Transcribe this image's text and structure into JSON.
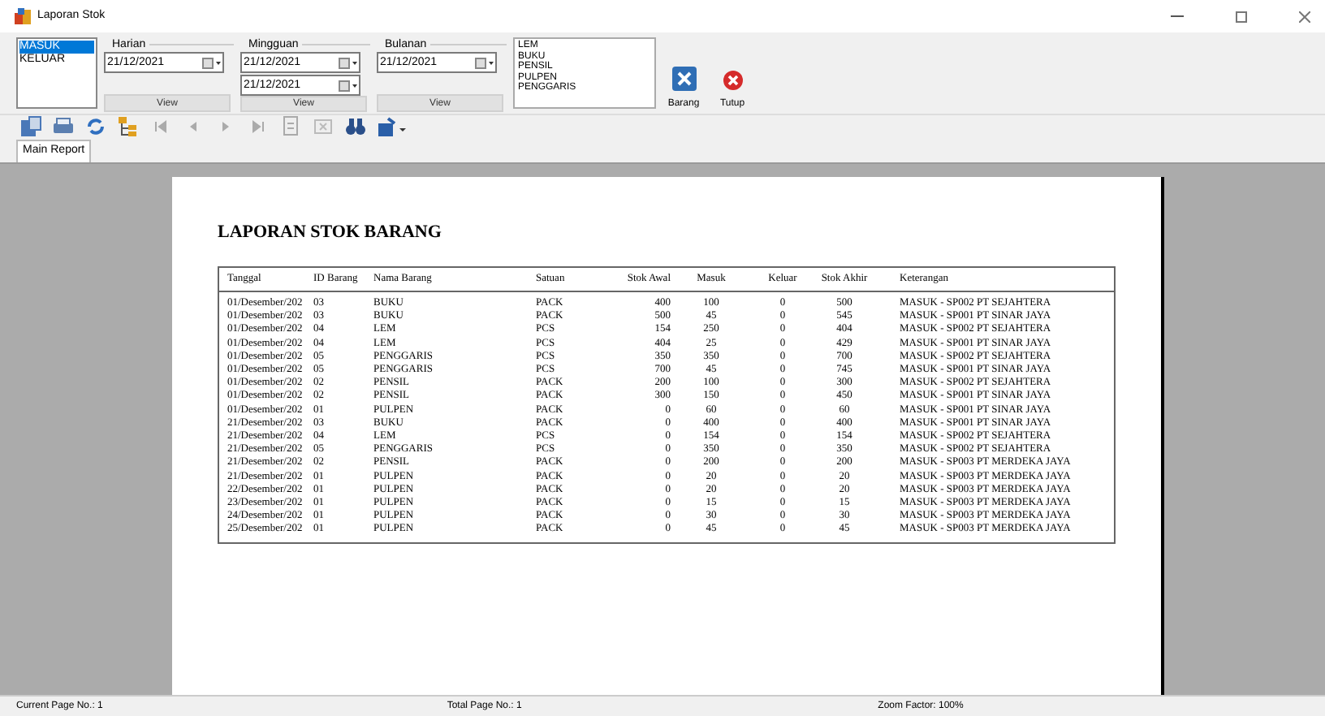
{
  "window": {
    "title": "Laporan Stok"
  },
  "type_list": [
    {
      "label": "MASUK",
      "selected": true
    },
    {
      "label": "KELUAR",
      "selected": false
    }
  ],
  "filters": [
    {
      "title": "Harian",
      "dates": [
        "21/12/2021"
      ],
      "button": "View"
    },
    {
      "title": "Mingguan",
      "dates": [
        "21/12/2021",
        "21/12/2021"
      ],
      "button": "View"
    },
    {
      "title": "Bulanan",
      "dates": [
        "21/12/2021"
      ],
      "button": "View"
    }
  ],
  "products": [
    "LEM",
    "BUKU",
    "PENSIL",
    "PULPEN",
    "PENGGARIS"
  ],
  "actions": [
    {
      "kind": "tools",
      "label": "Barang"
    },
    {
      "kind": "close",
      "label": "Tutup"
    }
  ],
  "report_tab": {
    "label": "Main Report",
    "selected": true
  },
  "report": {
    "title": "LAPORAN STOK BARANG",
    "columns": [
      "Tanggal",
      "ID Barang",
      "Nama Barang",
      "Satuan",
      "Stok Awal",
      "Masuk",
      "Keluar",
      "Stok Akhir",
      "Keterangan"
    ],
    "rows": [
      [
        "01/Desember/202",
        "03",
        "BUKU",
        "PACK",
        "400",
        "100",
        "0",
        "500",
        "MASUK - SP002 PT SEJAHTERA"
      ],
      [
        "01/Desember/202",
        "03",
        "BUKU",
        "PACK",
        "500",
        "45",
        "0",
        "545",
        "MASUK - SP001 PT SINAR JAYA"
      ],
      [
        "01/Desember/202",
        "04",
        "LEM",
        "PCS",
        "154",
        "250",
        "0",
        "404",
        "MASUK - SP002 PT SEJAHTERA"
      ],
      [
        "01/Desember/202",
        "04",
        "LEM",
        "PCS",
        "404",
        "25",
        "0",
        "429",
        "MASUK - SP001 PT SINAR JAYA"
      ],
      [
        "01/Desember/202",
        "05",
        "PENGGARIS",
        "PCS",
        "350",
        "350",
        "0",
        "700",
        "MASUK - SP002 PT SEJAHTERA"
      ],
      [
        "01/Desember/202",
        "05",
        "PENGGARIS",
        "PCS",
        "700",
        "45",
        "0",
        "745",
        "MASUK - SP001 PT SINAR JAYA"
      ],
      [
        "01/Desember/202",
        "02",
        "PENSIL",
        "PACK",
        "200",
        "100",
        "0",
        "300",
        "MASUK - SP002 PT SEJAHTERA"
      ],
      [
        "01/Desember/202",
        "02",
        "PENSIL",
        "PACK",
        "300",
        "150",
        "0",
        "450",
        "MASUK - SP001 PT SINAR JAYA"
      ],
      [
        "01/Desember/202",
        "01",
        "PULPEN",
        "PACK",
        "0",
        "60",
        "0",
        "60",
        "MASUK - SP001 PT SINAR JAYA"
      ],
      [
        "21/Desember/202",
        "03",
        "BUKU",
        "PACK",
        "0",
        "400",
        "0",
        "400",
        "MASUK - SP001 PT SINAR JAYA"
      ],
      [
        "21/Desember/202",
        "04",
        "LEM",
        "PCS",
        "0",
        "154",
        "0",
        "154",
        "MASUK - SP002 PT SEJAHTERA"
      ],
      [
        "21/Desember/202",
        "05",
        "PENGGARIS",
        "PCS",
        "0",
        "350",
        "0",
        "350",
        "MASUK - SP002 PT SEJAHTERA"
      ],
      [
        "21/Desember/202",
        "02",
        "PENSIL",
        "PACK",
        "0",
        "200",
        "0",
        "200",
        "MASUK - SP003 PT MERDEKA JAYA"
      ],
      [
        "21/Desember/202",
        "01",
        "PULPEN",
        "PACK",
        "0",
        "20",
        "0",
        "20",
        "MASUK - SP003 PT MERDEKA JAYA"
      ],
      [
        "22/Desember/202",
        "01",
        "PULPEN",
        "PACK",
        "0",
        "20",
        "0",
        "20",
        "MASUK - SP003 PT MERDEKA JAYA"
      ],
      [
        "23/Desember/202",
        "01",
        "PULPEN",
        "PACK",
        "0",
        "15",
        "0",
        "15",
        "MASUK - SP003 PT MERDEKA JAYA"
      ],
      [
        "24/Desember/202",
        "01",
        "PULPEN",
        "PACK",
        "0",
        "30",
        "0",
        "30",
        "MASUK - SP003 PT MERDEKA JAYA"
      ],
      [
        "25/Desember/202",
        "01",
        "PULPEN",
        "PACK",
        "0",
        "45",
        "0",
        "45",
        "MASUK - SP003 PT MERDEKA JAYA"
      ]
    ]
  },
  "status_bar": [
    "Current Page No.: 1",
    "Total Page No.: 1",
    "Zoom Factor: 100%"
  ]
}
